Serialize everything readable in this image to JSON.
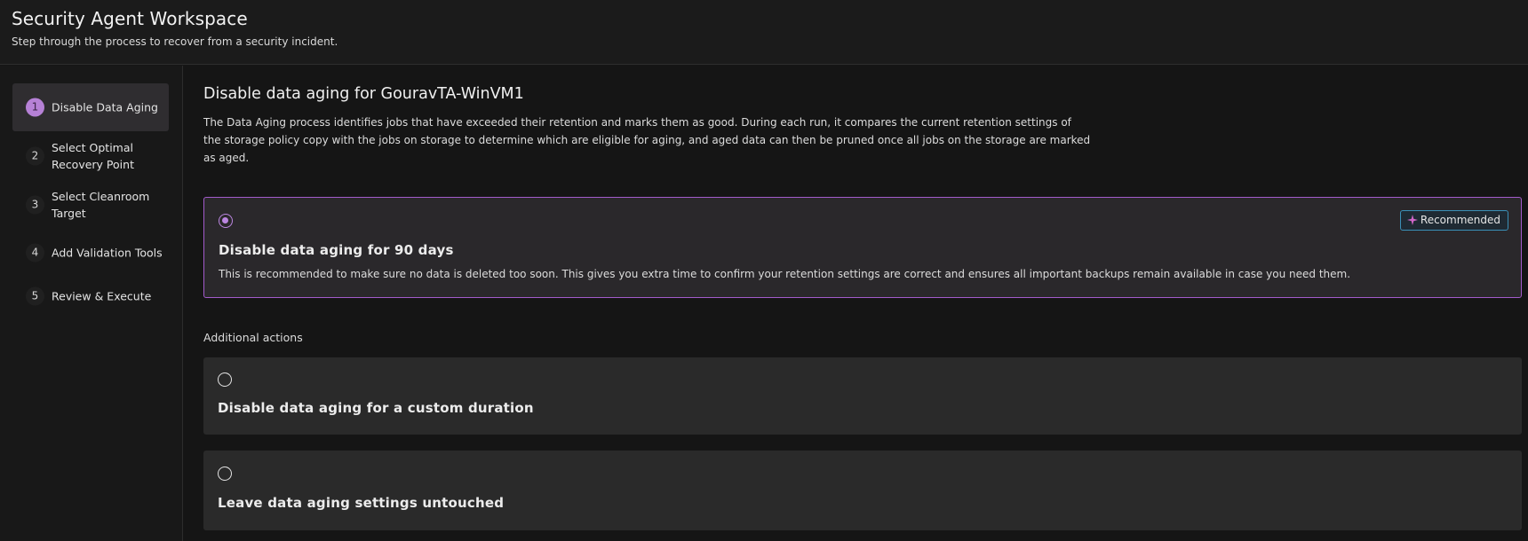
{
  "header": {
    "title": "Security Agent Workspace",
    "subtitle": "Step through the process to recover from a security incident."
  },
  "sidebar": {
    "steps": [
      {
        "number": "1",
        "label": "Disable Data Aging",
        "active": true
      },
      {
        "number": "2",
        "label": "Select Optimal Recovery Point",
        "active": false
      },
      {
        "number": "3",
        "label": "Select Cleanroom Target",
        "active": false
      },
      {
        "number": "4",
        "label": "Add Validation Tools",
        "active": false
      },
      {
        "number": "5",
        "label": "Review & Execute",
        "active": false
      }
    ]
  },
  "main": {
    "title": "Disable data aging for GouravTA-WinVM1",
    "description": "The Data Aging process identifies jobs that have exceeded their retention and marks them as good. During each run, it compares the current retention settings of the storage policy copy with the jobs on storage to determine which are eligible for aging, and aged data can then be pruned once all jobs on the storage are marked as aged.",
    "recommended_option": {
      "title": "Disable data aging for 90 days",
      "description": "This is recommended to make sure no data is deleted too soon. This gives you extra time to confirm your retention settings are correct and ensures all important backups remain available in case you need them.",
      "badge": "Recommended",
      "selected": true
    },
    "additional_label": "Additional actions",
    "additional_options": [
      {
        "title": "Disable data aging for a custom duration",
        "selected": false
      },
      {
        "title": "Leave data aging settings untouched",
        "selected": false
      }
    ]
  },
  "colors": {
    "accent": "#bb86e0",
    "selected_border": "#a35bcc",
    "badge_border": "#3a8fb7",
    "background": "#151515"
  }
}
